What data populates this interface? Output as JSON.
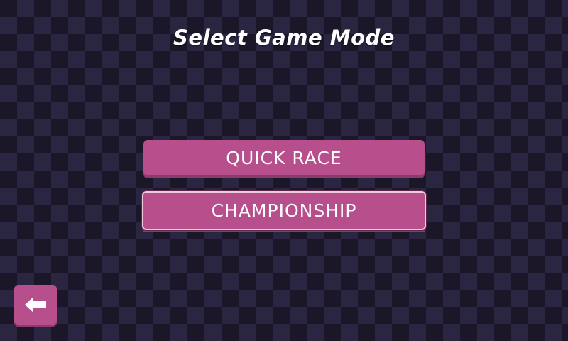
{
  "screen": {
    "title": "Select Game Mode"
  },
  "menu": {
    "quick_race_label": "QUICK RACE",
    "championship_label": "CHAMPIONSHIP",
    "selected": "championship"
  },
  "navigation": {
    "back_icon": "arrow-left-icon"
  },
  "colors": {
    "background_dark": "#1b1628",
    "background_checker": "#2a2540",
    "button": "#b64f8b",
    "button_shadow": "#8e3a6c",
    "selected_outline": "#f2c8dc",
    "text": "#ffffff"
  }
}
